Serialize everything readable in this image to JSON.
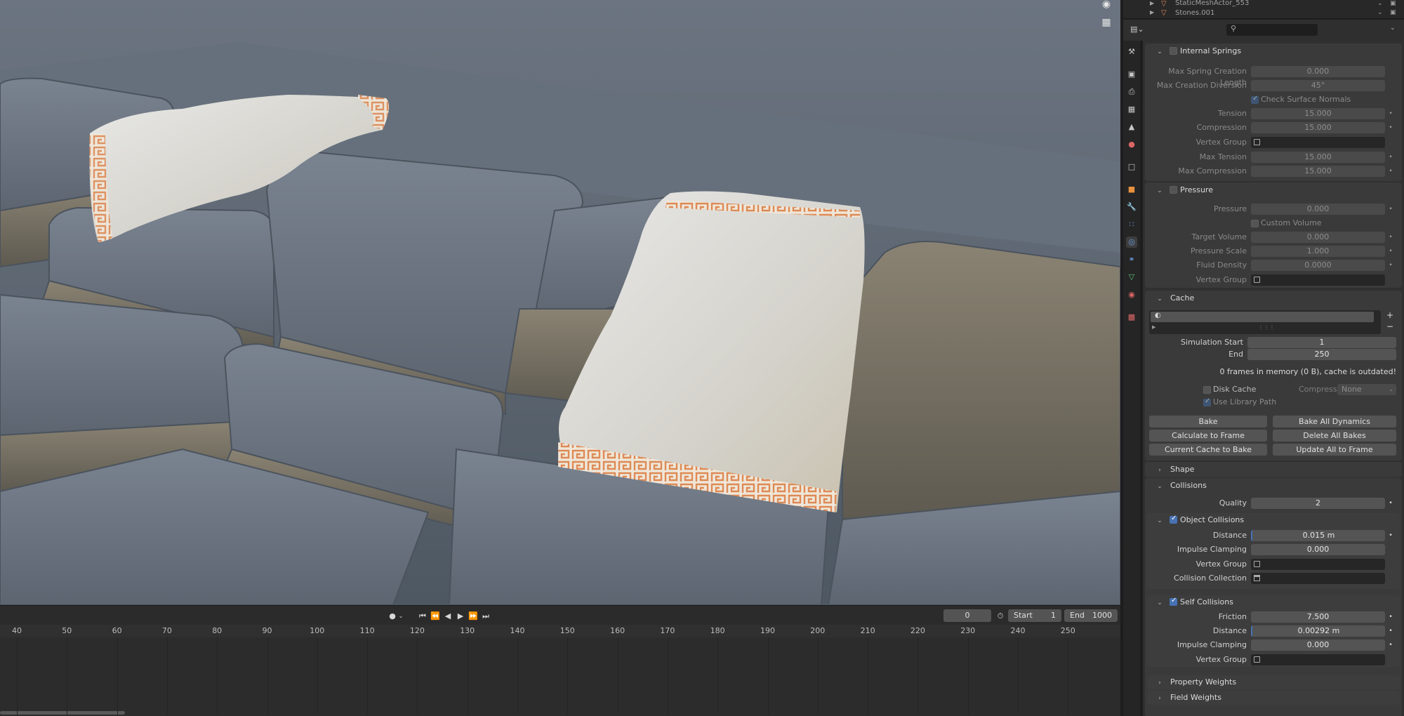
{
  "viewport": {
    "icons": [
      "camera-icon",
      "grid-icon"
    ]
  },
  "outliner": {
    "rows": [
      {
        "name": "StaticMeshActor_553"
      },
      {
        "name": "Stones.001"
      }
    ]
  },
  "properties": {
    "search_placeholder": "",
    "internal_springs": {
      "title": "Internal Springs",
      "max_spring_creation_length": {
        "label": "Max Spring Creation Length",
        "value": "0.000"
      },
      "max_creation_diversion": {
        "label": "Max Creation Diversion",
        "value": "45°"
      },
      "check_surface_normals": {
        "label": "Check Surface Normals"
      },
      "tension": {
        "label": "Tension",
        "value": "15.000"
      },
      "compression": {
        "label": "Compression",
        "value": "15.000"
      },
      "vertex_group": {
        "label": "Vertex Group"
      },
      "max_tension": {
        "label": "Max Tension",
        "value": "15.000"
      },
      "max_compression": {
        "label": "Max Compression",
        "value": "15.000"
      }
    },
    "pressure": {
      "title": "Pressure",
      "pressure": {
        "label": "Pressure",
        "value": "0.000"
      },
      "custom_volume": {
        "label": "Custom Volume"
      },
      "target_volume": {
        "label": "Target Volume",
        "value": "0.000"
      },
      "pressure_scale": {
        "label": "Pressure Scale",
        "value": "1.000"
      },
      "fluid_density": {
        "label": "Fluid Density",
        "value": "0.0000"
      },
      "vertex_group": {
        "label": "Vertex Group"
      }
    },
    "cache": {
      "title": "Cache",
      "simulation_start": {
        "label": "Simulation Start",
        "value": "1"
      },
      "end": {
        "label": "End",
        "value": "250"
      },
      "info": "0 frames in memory (0 B), cache is outdated!",
      "disk_cache": {
        "label": "Disk Cache"
      },
      "compression": {
        "label": "Compression",
        "value": "None"
      },
      "use_library_path": {
        "label": "Use Library Path"
      },
      "buttons": {
        "bake": "Bake",
        "bake_all": "Bake All Dynamics",
        "calc_to_frame": "Calculate to Frame",
        "delete_all": "Delete All Bakes",
        "current_cache": "Current Cache to Bake",
        "update_all": "Update All to Frame"
      }
    },
    "shape": {
      "title": "Shape"
    },
    "collisions": {
      "title": "Collisions",
      "quality": {
        "label": "Quality",
        "value": "2"
      }
    },
    "object_collisions": {
      "title": "Object Collisions",
      "distance": {
        "label": "Distance",
        "value": "0.015 m"
      },
      "impulse_clamping": {
        "label": "Impulse Clamping",
        "value": "0.000"
      },
      "vertex_group": {
        "label": "Vertex Group"
      },
      "collision_collection": {
        "label": "Collision Collection"
      }
    },
    "self_collisions": {
      "title": "Self Collisions",
      "friction": {
        "label": "Friction",
        "value": "7.500"
      },
      "distance": {
        "label": "Distance",
        "value": "0.00292 m"
      },
      "impulse_clamping": {
        "label": "Impulse Clamping",
        "value": "0.000"
      },
      "vertex_group": {
        "label": "Vertex Group"
      }
    },
    "property_weights": {
      "title": "Property Weights"
    },
    "field_weights": {
      "title": "Field Weights"
    }
  },
  "playback": {
    "current_frame": "0",
    "start_label": "Start",
    "start_value": "1",
    "end_label": "End",
    "end_value": "1000"
  },
  "timeline": {
    "ticks": [
      "40",
      "50",
      "60",
      "70",
      "80",
      "90",
      "100",
      "110",
      "120",
      "130",
      "140",
      "150",
      "160",
      "170",
      "180",
      "190",
      "200",
      "210",
      "220",
      "230",
      "240",
      "250"
    ]
  },
  "colors": {
    "accent": "#4772b3",
    "panel": "#3a3a3a",
    "field": "#545454"
  }
}
